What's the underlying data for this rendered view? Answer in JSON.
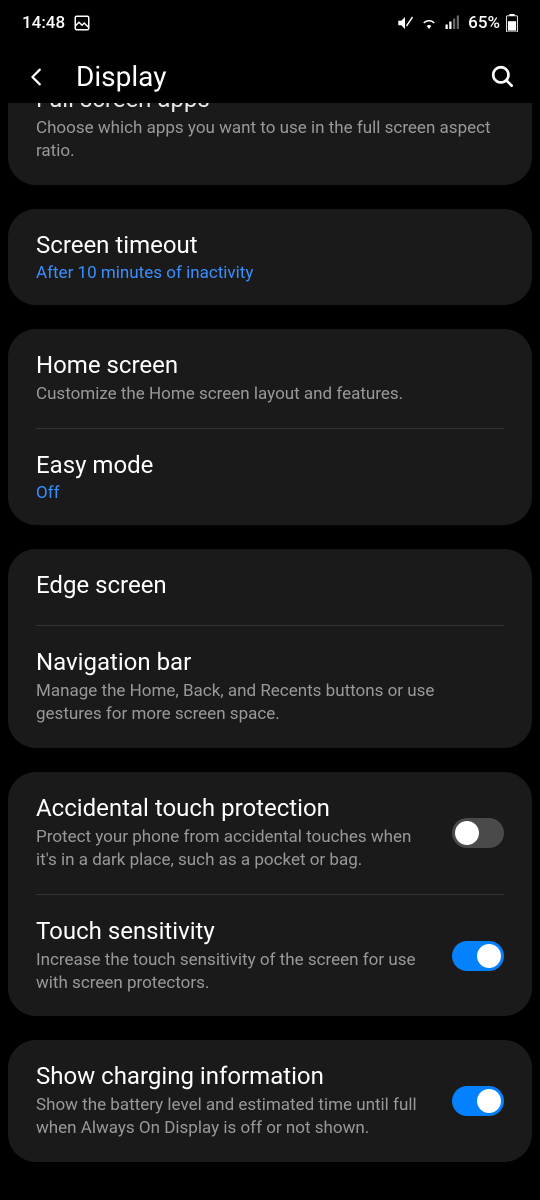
{
  "statusBar": {
    "time": "14:48",
    "battery": "65%"
  },
  "header": {
    "title": "Display"
  },
  "groups": [
    {
      "partialTop": true,
      "items": [
        {
          "title": "Full screen apps",
          "desc": "Choose which apps you want to use in the full screen aspect ratio.",
          "partialHidden": true
        }
      ]
    },
    {
      "items": [
        {
          "title": "Screen timeout",
          "value": "After 10 minutes of inactivity"
        }
      ]
    },
    {
      "items": [
        {
          "title": "Home screen",
          "desc": "Customize the Home screen layout and features."
        },
        {
          "title": "Easy mode",
          "value": "Off"
        }
      ]
    },
    {
      "items": [
        {
          "title": "Edge screen"
        },
        {
          "title": "Navigation bar",
          "desc": "Manage the Home, Back, and Recents buttons or use gestures for more screen space."
        }
      ]
    },
    {
      "items": [
        {
          "title": "Accidental touch protection",
          "desc": "Protect your phone from accidental touches when it's in a dark place, such as a pocket or bag.",
          "toggle": "off"
        },
        {
          "title": "Touch sensitivity",
          "desc": "Increase the touch sensitivity of the screen for use with screen protectors.",
          "toggle": "on"
        }
      ]
    },
    {
      "items": [
        {
          "title": "Show charging information",
          "desc": "Show the battery level and estimated time until full when Always On Display is off or not shown.",
          "toggle": "on"
        }
      ]
    }
  ]
}
